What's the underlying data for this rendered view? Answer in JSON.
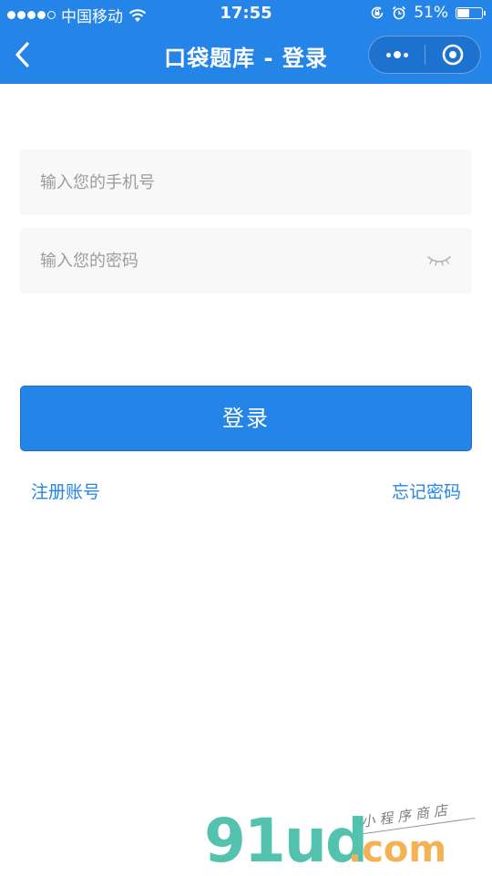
{
  "status_bar": {
    "carrier": "中国移动",
    "time": "17:55",
    "battery_percent_label": "51%",
    "battery_level": 0.51,
    "signal_bars_filled": 4,
    "signal_bars_total": 5,
    "icons": [
      "wifi-icon",
      "rotation-lock-icon",
      "alarm-icon",
      "battery-icon"
    ]
  },
  "nav": {
    "title": "口袋题库 - 登录",
    "back_icon": "chevron-left-icon",
    "more_icon": "more-dots-icon",
    "close_icon": "target-close-icon"
  },
  "form": {
    "phone_placeholder": "输入您的手机号",
    "phone_value": "",
    "password_placeholder": "输入您的密码",
    "password_value": "",
    "eye_icon": "eye-closed-icon",
    "login_label": "登录"
  },
  "links": {
    "register": "注册账号",
    "forgot": "忘记密码"
  },
  "watermark": {
    "logo": "91ud",
    "suffix": ".com",
    "tagline": "小程序商店"
  },
  "colors": {
    "primary": "#2584e8",
    "input_bg": "#f8f8f8",
    "placeholder": "#9c9c9c",
    "watermark_green": "#53c3b0",
    "watermark_orange": "#f4b253"
  }
}
